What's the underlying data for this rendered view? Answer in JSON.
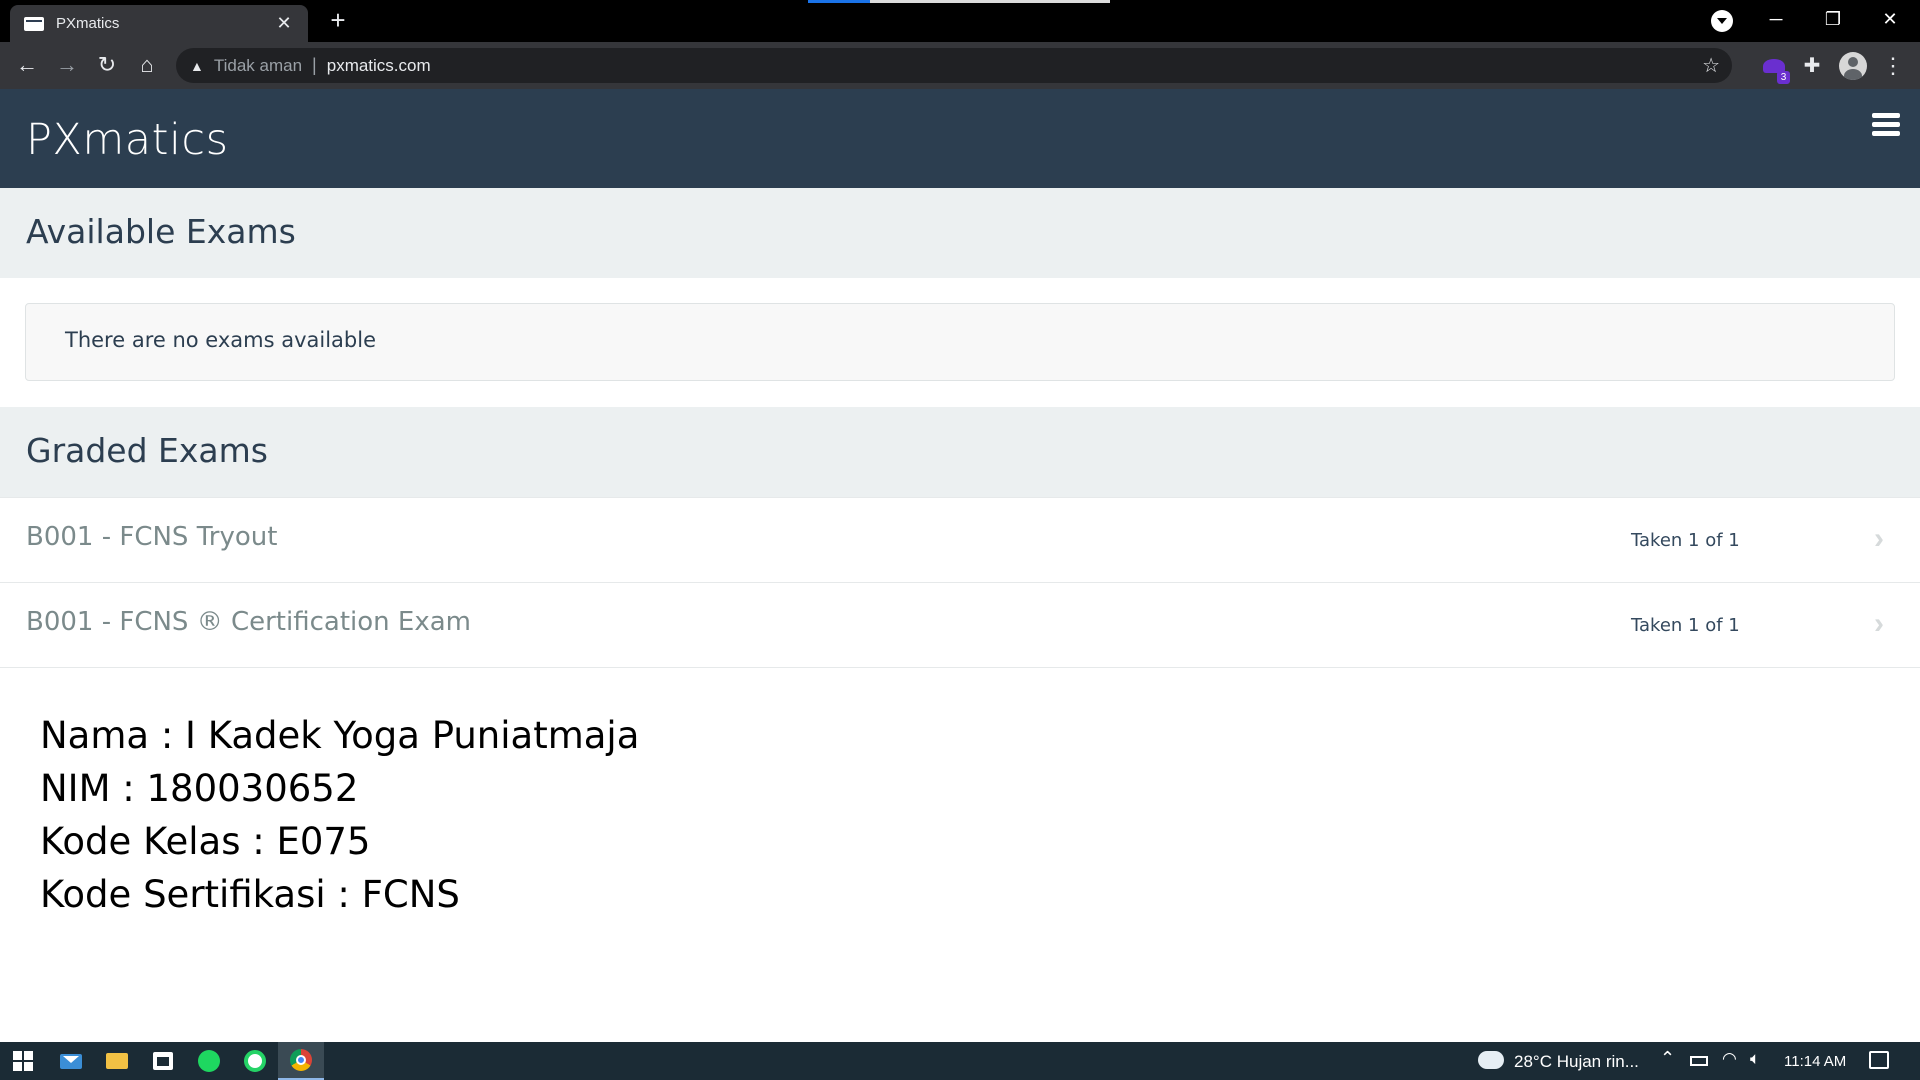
{
  "browser": {
    "tab_title": "PXmatics",
    "tab_close": "✕",
    "new_tab": "+",
    "window_min": "─",
    "window_max": "❐",
    "window_close": "✕",
    "security_label": "Tidak aman",
    "separator": "|",
    "url": "pxmatics.com",
    "extension_badge": "3",
    "icons": [
      "back-icon",
      "forward-icon",
      "reload-icon",
      "home-icon",
      "warning-icon",
      "star-icon",
      "extensions-icon",
      "profile-icon",
      "menu-icon"
    ]
  },
  "site": {
    "brand": "PXmatics",
    "colors": {
      "navbar": "#2c3e50",
      "section": "#ecf0f1",
      "muted_text": "#7b8a8b"
    }
  },
  "available": {
    "heading": "Available Exams",
    "empty_message": "There are no exams available"
  },
  "graded": {
    "heading": "Graded Exams",
    "exams": [
      {
        "name": "B001 - FCNS Tryout",
        "status": "Taken 1 of 1"
      },
      {
        "name": "B001 - FCNS ® Certification Exam",
        "status": "Taken 1 of 1"
      }
    ]
  },
  "info": {
    "line1": "Nama : I Kadek Yoga Puniatmaja",
    "line2": "NIM : 180030652",
    "line3": "Kode Kelas : E075",
    "line4": "Kode Sertifikasi : FCNS"
  },
  "taskbar": {
    "apps": [
      "windows-start",
      "mail",
      "file-explorer",
      "microsoft-store",
      "spotify",
      "whatsapp",
      "chrome"
    ],
    "weather": "28°C  Hujan rin...",
    "time": "11:14 AM"
  }
}
